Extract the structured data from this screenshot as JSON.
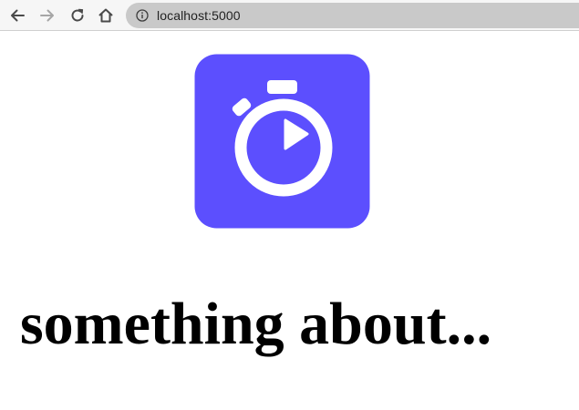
{
  "browser": {
    "url": "localhost:5000",
    "icons": {
      "back": "arrow-left-icon",
      "forward": "arrow-right-icon",
      "reload": "reload-icon",
      "home": "home-icon",
      "site_info": "info-icon"
    }
  },
  "page": {
    "logo": {
      "icon": "stopwatch-icon",
      "background_color": "#5c4ffe",
      "foreground_color": "#ffffff"
    },
    "heading": "something about..."
  }
}
